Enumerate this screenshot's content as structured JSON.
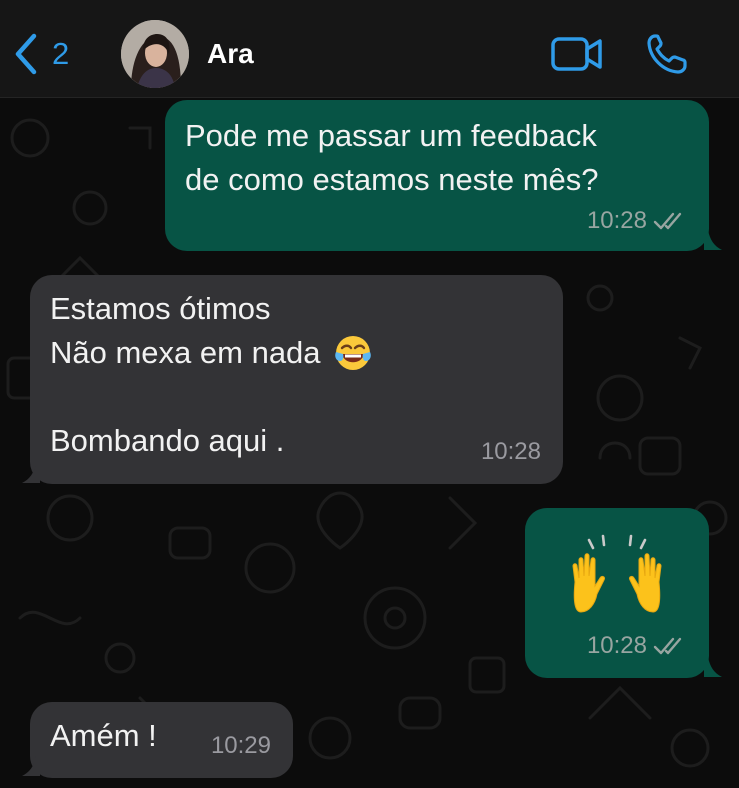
{
  "header": {
    "back_count": "2",
    "contact_name": "Ara"
  },
  "messages": [
    {
      "direction": "outgoing",
      "text": "Pode me passar um feedback\nde como estamos neste mês?",
      "time": "10:28",
      "status": "read"
    },
    {
      "direction": "incoming",
      "line1": "Estamos ótimos",
      "line2": "Não mexa em nada",
      "line2_emoji": "face-with-tears-of-joy",
      "line3": "Bombando aqui .",
      "time": "10:28"
    },
    {
      "direction": "outgoing",
      "emoji": "raising-hands",
      "time": "10:28",
      "status": "read"
    },
    {
      "direction": "incoming",
      "text": "Amém !",
      "time": "10:29"
    }
  ],
  "colors": {
    "accent": "#2f9be8",
    "outgoing_bubble": "#075445",
    "incoming_bubble": "#333336",
    "header_bg": "#161616",
    "chat_bg": "#0c0c0c"
  },
  "icons": [
    "back-chevron-icon",
    "video-call-icon",
    "phone-icon",
    "double-check-icon"
  ]
}
